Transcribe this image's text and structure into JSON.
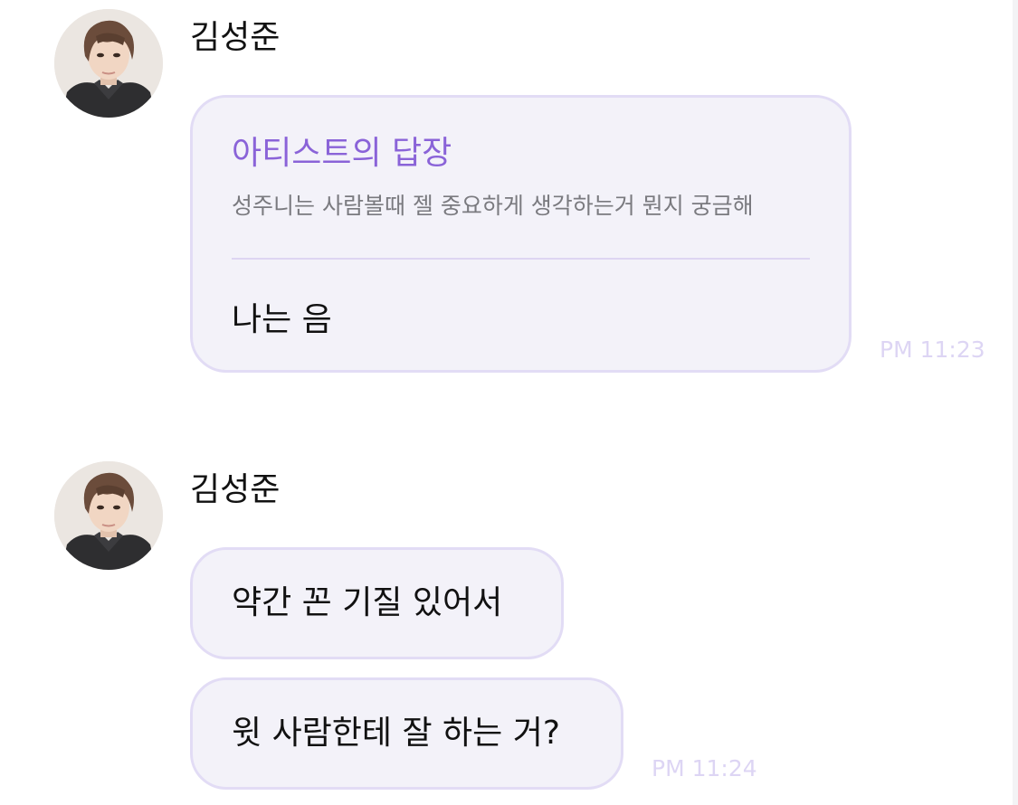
{
  "messages": [
    {
      "sender": "김성준",
      "reply_card": {
        "title": "아티스트의 답장",
        "quoted_question": "성주니는 사람볼때 젤 중요하게 생각하는거 뭔지 궁금해",
        "answer": "나는 음"
      },
      "time": "PM 11:23"
    },
    {
      "sender": "김성준",
      "bubbles": [
        "약간 꼰 기질 있어서",
        "윗 사람한테 잘 하는 거?"
      ],
      "time": "PM 11:24"
    }
  ],
  "colors": {
    "background": "#ffffff",
    "bubble_fill": "#f3f2f9",
    "bubble_border": "#e2dcf5",
    "reply_title": "#8a63d8",
    "quote_text": "#7a7a7f",
    "timestamp": "#ddd5f4"
  },
  "icons": {
    "avatar": "artist-profile-photo"
  }
}
